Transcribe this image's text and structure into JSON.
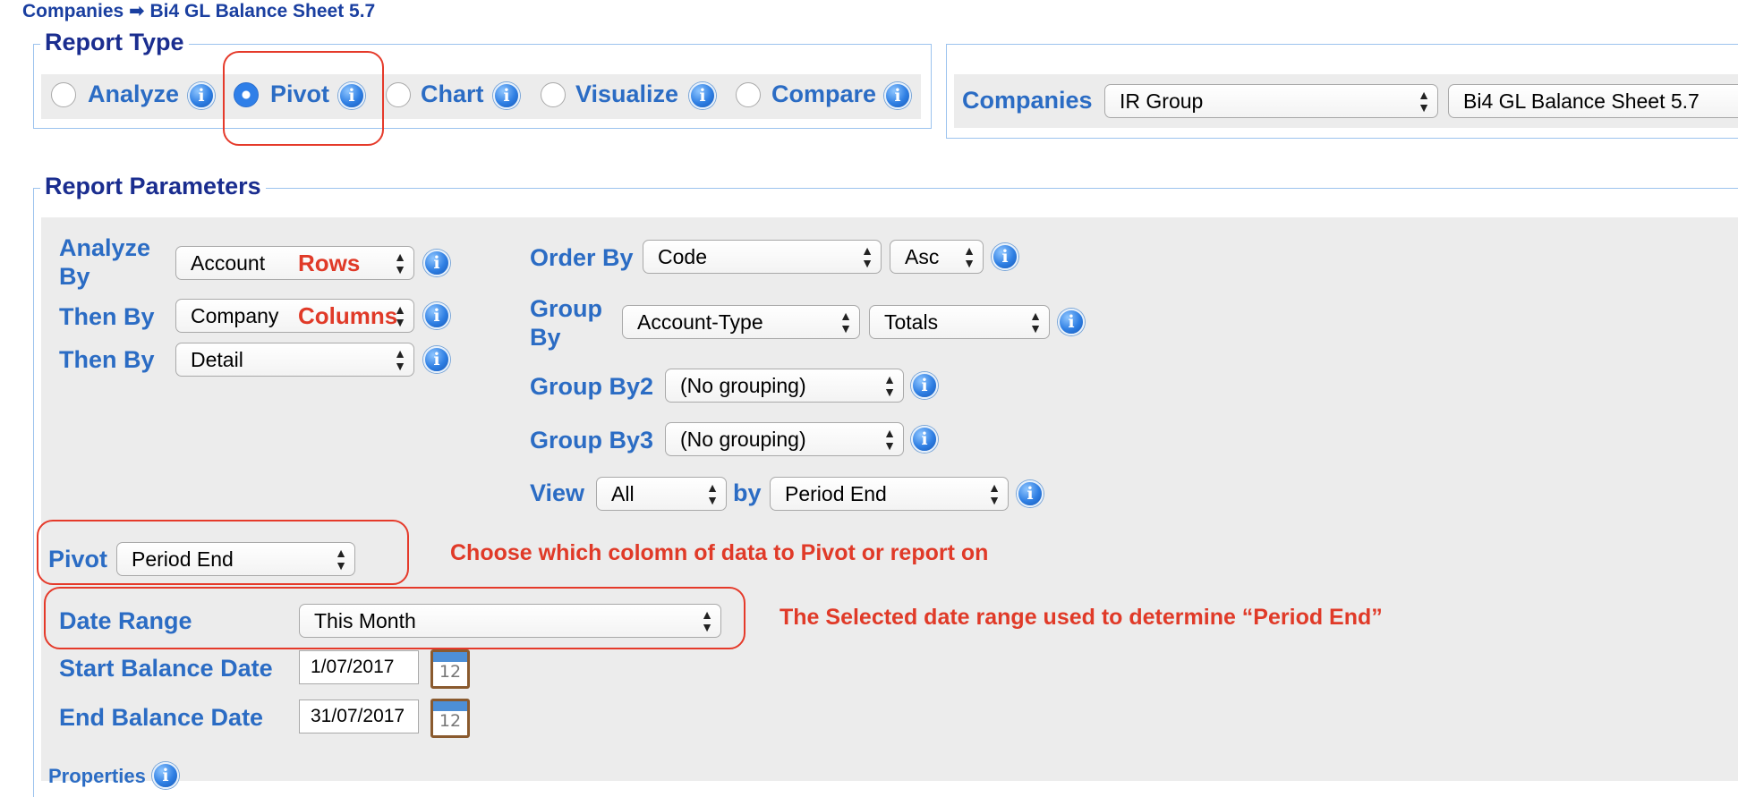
{
  "breadcrumb": {
    "parent": "Companies",
    "arrow": "➡",
    "current": "Bi4 GL Balance Sheet 5.7"
  },
  "report_type": {
    "legend": "Report Type",
    "options": [
      {
        "label": "Analyze",
        "selected": false
      },
      {
        "label": "Pivot",
        "selected": true
      },
      {
        "label": "Chart",
        "selected": false
      },
      {
        "label": "Visualize",
        "selected": false
      },
      {
        "label": "Compare",
        "selected": false
      }
    ]
  },
  "companies": {
    "label": "Companies",
    "group_value": "IR Group",
    "report_value": "Bi4 GL Balance Sheet 5.7"
  },
  "params": {
    "legend": "Report Parameters",
    "analyze_by": {
      "label_line1": "Analyze",
      "label_line2": "By",
      "value": "Account",
      "note": "Rows"
    },
    "then_by_1": {
      "label": "Then By",
      "value": "Company",
      "note": "Columns"
    },
    "then_by_2": {
      "label": "Then By",
      "value": "Detail"
    },
    "order_by": {
      "label": "Order By",
      "value": "Code",
      "direction": "Asc"
    },
    "group_by": {
      "label_line1": "Group",
      "label_line2": "By",
      "value": "Account-Type",
      "mode": "Totals"
    },
    "group_by2": {
      "label": "Group By2",
      "value": "(No grouping)"
    },
    "group_by3": {
      "label": "Group By3",
      "value": "(No grouping)"
    },
    "view": {
      "label": "View",
      "value": "All",
      "by_label": "by",
      "by_value": "Period End"
    },
    "pivot": {
      "label": "Pivot",
      "value": "Period End",
      "note": "Choose which colomn of data to Pivot or report on"
    },
    "date_range": {
      "label": "Date Range",
      "value": "This Month",
      "note": "The Selected date range used to determine “Period End”"
    },
    "start_date": {
      "label": "Start Balance Date",
      "value": "1/07/2017",
      "calendar_day": "12"
    },
    "end_date": {
      "label": "End Balance Date",
      "value": "31/07/2017",
      "calendar_day": "12"
    },
    "properties": {
      "label": "Properties"
    }
  },
  "colors": {
    "label_blue": "#2b6cc4",
    "legend_navy": "#1a2d8f",
    "annotation_red": "#e03a28",
    "panel_gray": "#ececec"
  },
  "icons": {
    "info": "info-icon",
    "calendar": "calendar-icon",
    "select_arrows": "up-down-arrows"
  }
}
